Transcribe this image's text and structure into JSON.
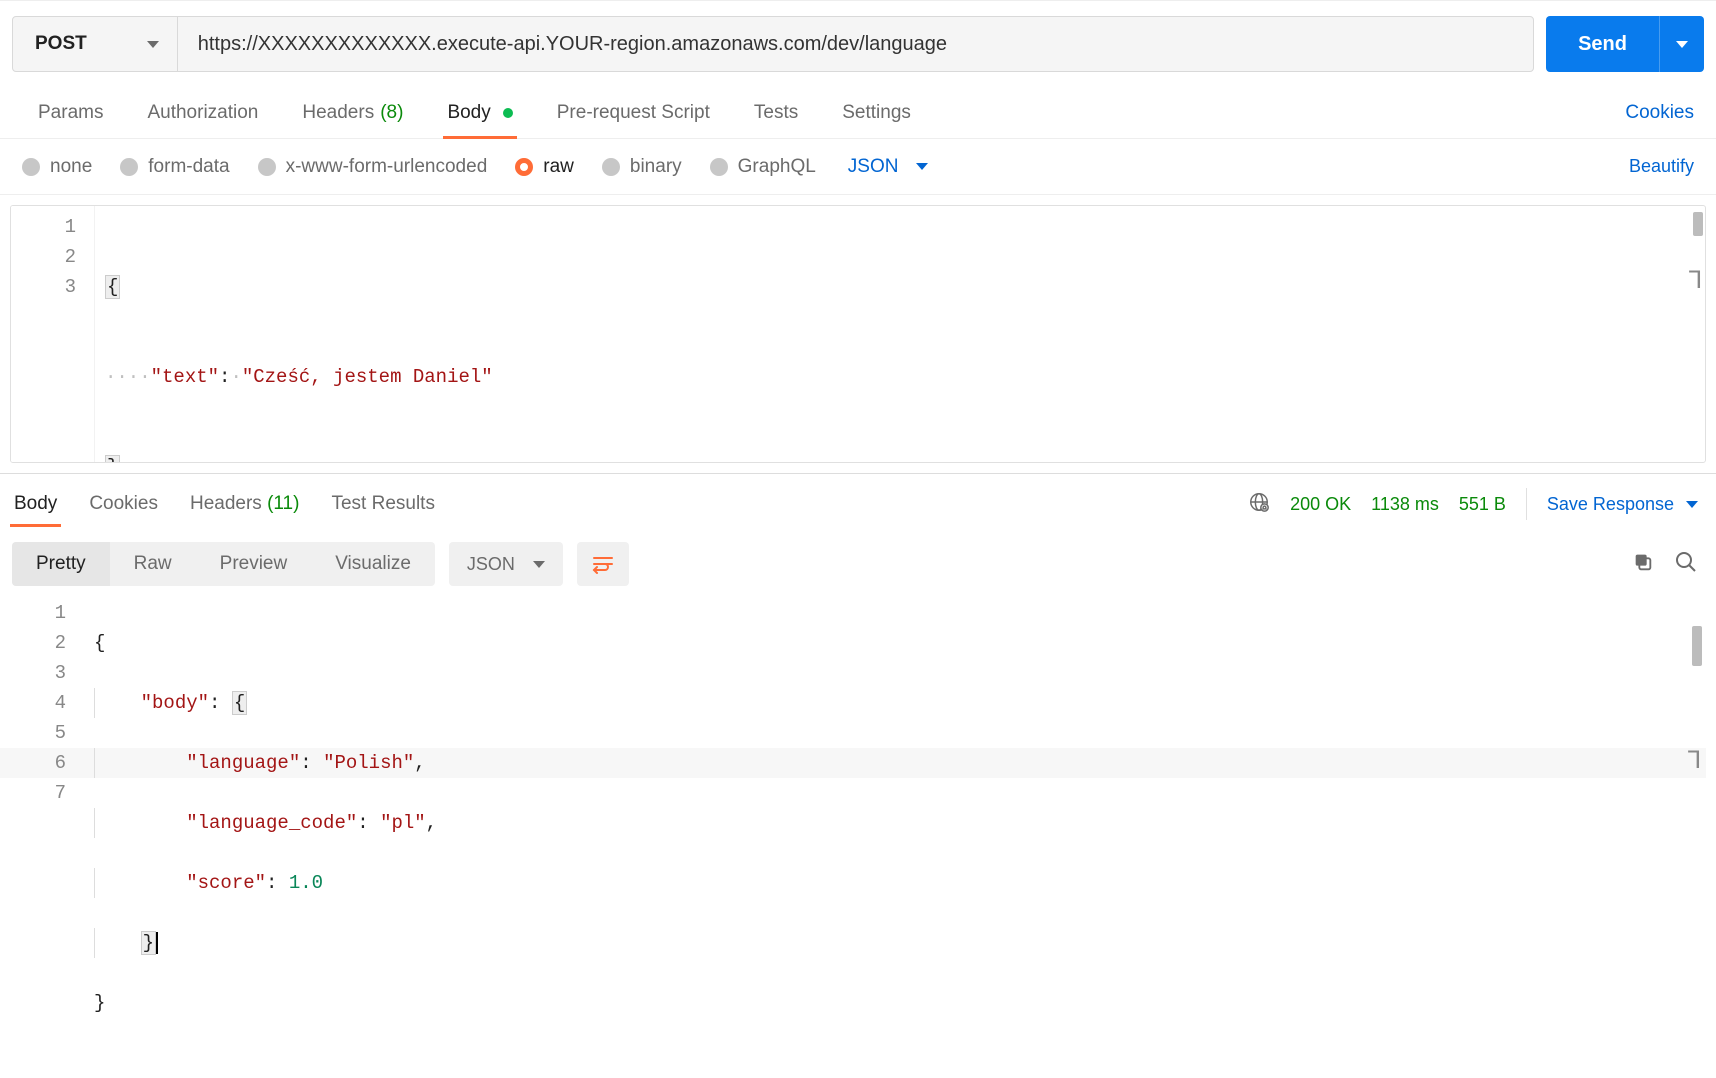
{
  "request": {
    "method": "POST",
    "url": "https://XXXXXXXXXXXXX.execute-api.YOUR-region.amazonaws.com/dev/language",
    "send_label": "Send"
  },
  "tabs": {
    "params": "Params",
    "authorization": "Authorization",
    "headers_label": "Headers",
    "headers_count": "(8)",
    "body": "Body",
    "prerequest": "Pre-request Script",
    "tests": "Tests",
    "settings": "Settings",
    "cookies_link": "Cookies"
  },
  "body_types": {
    "none": "none",
    "form_data": "form-data",
    "x_www": "x-www-form-urlencoded",
    "raw": "raw",
    "binary": "binary",
    "graphql": "GraphQL",
    "lang": "JSON",
    "beautify": "Beautify"
  },
  "request_body": {
    "line_numbers": [
      "1",
      "2",
      "3"
    ],
    "l1": "{",
    "l2_key": "\"text\"",
    "l2_sep": ":",
    "l2_val": "\"Cześć, jestem Daniel\"",
    "l3": "}"
  },
  "response_tabs": {
    "body": "Body",
    "cookies": "Cookies",
    "headers_label": "Headers",
    "headers_count": "(11)",
    "test_results": "Test Results"
  },
  "response_meta": {
    "status_code": "200",
    "status_text": "OK",
    "time": "1138 ms",
    "size": "551 B",
    "save_response": "Save Response"
  },
  "response_toolbar": {
    "pretty": "Pretty",
    "raw": "Raw",
    "preview": "Preview",
    "visualize": "Visualize",
    "lang": "JSON"
  },
  "response_body": {
    "line_numbers": [
      "1",
      "2",
      "3",
      "4",
      "5",
      "6",
      "7"
    ],
    "l1": "{",
    "l2_key": "\"body\"",
    "l2_sep": ":",
    "l2_open": "{",
    "l3_key": "\"language\"",
    "l3_val": "\"Polish\"",
    "l4_key": "\"language_code\"",
    "l4_val": "\"pl\"",
    "l5_key": "\"score\"",
    "l5_val": "1.0",
    "l6": "}",
    "l7": "}"
  }
}
